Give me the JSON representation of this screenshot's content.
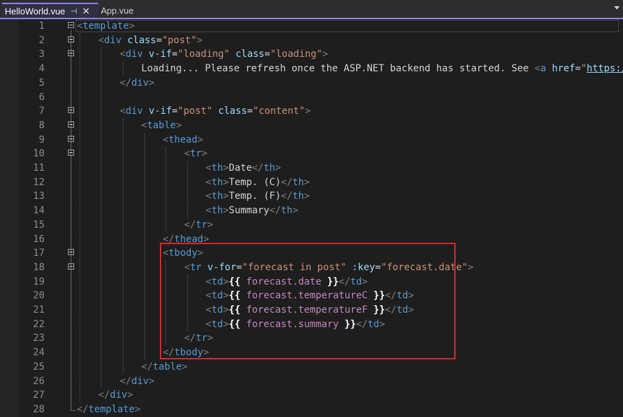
{
  "tabs": [
    {
      "label": "HelloWorld.vue",
      "active": true,
      "pinned": true
    },
    {
      "label": "App.vue",
      "active": false
    }
  ],
  "icons": {
    "pin": "pin-icon",
    "close": "close-icon",
    "overflow": "chevron-down-icon",
    "fold": "collapse-icon"
  },
  "colors": {
    "accent": "#9184ee",
    "highlight": "#e0262b",
    "tag": "#569cd6",
    "attribute": "#9cdcfe",
    "value": "#ce9178",
    "expression": "#c586c0"
  },
  "editor": {
    "highlight_lines": [
      17,
      24
    ],
    "lines": [
      {
        "n": "1",
        "indent": 0,
        "fold": true,
        "tokens": [
          {
            "t": "t",
            "v": "<"
          },
          {
            "t": "tn",
            "v": "template"
          },
          {
            "t": "t",
            "v": ">"
          }
        ]
      },
      {
        "n": "2",
        "indent": 1,
        "fold": true,
        "tokens": [
          {
            "t": "t",
            "v": "<"
          },
          {
            "t": "tn",
            "v": "div"
          },
          {
            "t": "tx",
            "v": " "
          },
          {
            "t": "an",
            "v": "class"
          },
          {
            "t": "tx",
            "v": "="
          },
          {
            "t": "av",
            "v": "\"post\""
          },
          {
            "t": "t",
            "v": ">"
          }
        ]
      },
      {
        "n": "3",
        "indent": 2,
        "fold": true,
        "tokens": [
          {
            "t": "t",
            "v": "<"
          },
          {
            "t": "tn",
            "v": "div"
          },
          {
            "t": "tx",
            "v": " "
          },
          {
            "t": "an",
            "v": "v-if"
          },
          {
            "t": "tx",
            "v": "="
          },
          {
            "t": "av",
            "v": "\"loading\""
          },
          {
            "t": "tx",
            "v": " "
          },
          {
            "t": "an",
            "v": "class"
          },
          {
            "t": "tx",
            "v": "="
          },
          {
            "t": "av",
            "v": "\"loading\""
          },
          {
            "t": "t",
            "v": ">"
          }
        ]
      },
      {
        "n": "4",
        "indent": 3,
        "fold": false,
        "tokens": [
          {
            "t": "tx",
            "v": "Loading... Please refresh once the ASP.NET backend has started. See "
          },
          {
            "t": "t",
            "v": "<"
          },
          {
            "t": "tn",
            "v": "a"
          },
          {
            "t": "tx",
            "v": " "
          },
          {
            "t": "an",
            "v": "href"
          },
          {
            "t": "tx",
            "v": "="
          },
          {
            "t": "av",
            "v": "\""
          },
          {
            "t": "lnk",
            "v": "https://aka."
          }
        ]
      },
      {
        "n": "5",
        "indent": 2,
        "fold": false,
        "tokens": [
          {
            "t": "t",
            "v": "</"
          },
          {
            "t": "tn",
            "v": "div"
          },
          {
            "t": "t",
            "v": ">"
          }
        ]
      },
      {
        "n": "6",
        "indent": 0,
        "fold": false,
        "tokens": []
      },
      {
        "n": "7",
        "indent": 2,
        "fold": true,
        "tokens": [
          {
            "t": "t",
            "v": "<"
          },
          {
            "t": "tn",
            "v": "div"
          },
          {
            "t": "tx",
            "v": " "
          },
          {
            "t": "an",
            "v": "v-if"
          },
          {
            "t": "tx",
            "v": "="
          },
          {
            "t": "av",
            "v": "\"post\""
          },
          {
            "t": "tx",
            "v": " "
          },
          {
            "t": "an",
            "v": "class"
          },
          {
            "t": "tx",
            "v": "="
          },
          {
            "t": "av",
            "v": "\"content\""
          },
          {
            "t": "t",
            "v": ">"
          }
        ]
      },
      {
        "n": "8",
        "indent": 3,
        "fold": true,
        "tokens": [
          {
            "t": "t",
            "v": "<"
          },
          {
            "t": "tn",
            "v": "table"
          },
          {
            "t": "t",
            "v": ">"
          }
        ]
      },
      {
        "n": "9",
        "indent": 4,
        "fold": true,
        "tokens": [
          {
            "t": "t",
            "v": "<"
          },
          {
            "t": "tn",
            "v": "thead"
          },
          {
            "t": "t",
            "v": ">"
          }
        ]
      },
      {
        "n": "10",
        "indent": 5,
        "fold": true,
        "tokens": [
          {
            "t": "t",
            "v": "<"
          },
          {
            "t": "tn",
            "v": "tr"
          },
          {
            "t": "t",
            "v": ">"
          }
        ]
      },
      {
        "n": "11",
        "indent": 6,
        "fold": false,
        "tokens": [
          {
            "t": "t",
            "v": "<"
          },
          {
            "t": "tn",
            "v": "th"
          },
          {
            "t": "t",
            "v": ">"
          },
          {
            "t": "tx",
            "v": "Date"
          },
          {
            "t": "t",
            "v": "</"
          },
          {
            "t": "tn",
            "v": "th"
          },
          {
            "t": "t",
            "v": ">"
          }
        ]
      },
      {
        "n": "12",
        "indent": 6,
        "fold": false,
        "tokens": [
          {
            "t": "t",
            "v": "<"
          },
          {
            "t": "tn",
            "v": "th"
          },
          {
            "t": "t",
            "v": ">"
          },
          {
            "t": "tx",
            "v": "Temp. (C)"
          },
          {
            "t": "t",
            "v": "</"
          },
          {
            "t": "tn",
            "v": "th"
          },
          {
            "t": "t",
            "v": ">"
          }
        ]
      },
      {
        "n": "13",
        "indent": 6,
        "fold": false,
        "tokens": [
          {
            "t": "t",
            "v": "<"
          },
          {
            "t": "tn",
            "v": "th"
          },
          {
            "t": "t",
            "v": ">"
          },
          {
            "t": "tx",
            "v": "Temp. (F)"
          },
          {
            "t": "t",
            "v": "</"
          },
          {
            "t": "tn",
            "v": "th"
          },
          {
            "t": "t",
            "v": ">"
          }
        ]
      },
      {
        "n": "14",
        "indent": 6,
        "fold": false,
        "tokens": [
          {
            "t": "t",
            "v": "<"
          },
          {
            "t": "tn",
            "v": "th"
          },
          {
            "t": "t",
            "v": ">"
          },
          {
            "t": "tx",
            "v": "Summary"
          },
          {
            "t": "t",
            "v": "</"
          },
          {
            "t": "tn",
            "v": "th"
          },
          {
            "t": "t",
            "v": ">"
          }
        ]
      },
      {
        "n": "15",
        "indent": 5,
        "fold": false,
        "tokens": [
          {
            "t": "t",
            "v": "</"
          },
          {
            "t": "tn",
            "v": "tr"
          },
          {
            "t": "t",
            "v": ">"
          }
        ]
      },
      {
        "n": "16",
        "indent": 4,
        "fold": false,
        "tokens": [
          {
            "t": "t",
            "v": "</"
          },
          {
            "t": "tn",
            "v": "thead"
          },
          {
            "t": "t",
            "v": ">"
          }
        ]
      },
      {
        "n": "17",
        "indent": 4,
        "fold": true,
        "tokens": [
          {
            "t": "t",
            "v": "<"
          },
          {
            "t": "tn",
            "v": "tbody"
          },
          {
            "t": "t",
            "v": ">"
          }
        ]
      },
      {
        "n": "18",
        "indent": 5,
        "fold": true,
        "tokens": [
          {
            "t": "t",
            "v": "<"
          },
          {
            "t": "tn",
            "v": "tr"
          },
          {
            "t": "tx",
            "v": " "
          },
          {
            "t": "an",
            "v": "v-for"
          },
          {
            "t": "tx",
            "v": "="
          },
          {
            "t": "av",
            "v": "\"forecast in post\""
          },
          {
            "t": "tx",
            "v": " "
          },
          {
            "t": "an",
            "v": ":key"
          },
          {
            "t": "tx",
            "v": "="
          },
          {
            "t": "av",
            "v": "\"forecast.date\""
          },
          {
            "t": "t",
            "v": ">"
          }
        ]
      },
      {
        "n": "19",
        "indent": 6,
        "fold": false,
        "tokens": [
          {
            "t": "t",
            "v": "<"
          },
          {
            "t": "tn",
            "v": "td"
          },
          {
            "t": "t",
            "v": ">"
          },
          {
            "t": "br",
            "v": "{{"
          },
          {
            "t": "tx",
            "v": " "
          },
          {
            "t": "ex",
            "v": "forecast.date"
          },
          {
            "t": "tx",
            "v": " "
          },
          {
            "t": "br",
            "v": "}}"
          },
          {
            "t": "t",
            "v": "</"
          },
          {
            "t": "tn",
            "v": "td"
          },
          {
            "t": "t",
            "v": ">"
          }
        ]
      },
      {
        "n": "20",
        "indent": 6,
        "fold": false,
        "tokens": [
          {
            "t": "t",
            "v": "<"
          },
          {
            "t": "tn",
            "v": "td"
          },
          {
            "t": "t",
            "v": ">"
          },
          {
            "t": "br",
            "v": "{{"
          },
          {
            "t": "tx",
            "v": " "
          },
          {
            "t": "ex",
            "v": "forecast.temperatureC"
          },
          {
            "t": "tx",
            "v": " "
          },
          {
            "t": "br",
            "v": "}}"
          },
          {
            "t": "t",
            "v": "</"
          },
          {
            "t": "tn",
            "v": "td"
          },
          {
            "t": "t",
            "v": ">"
          }
        ]
      },
      {
        "n": "21",
        "indent": 6,
        "fold": false,
        "tokens": [
          {
            "t": "t",
            "v": "<"
          },
          {
            "t": "tn",
            "v": "td"
          },
          {
            "t": "t",
            "v": ">"
          },
          {
            "t": "br",
            "v": "{{"
          },
          {
            "t": "tx",
            "v": " "
          },
          {
            "t": "ex",
            "v": "forecast.temperatureF"
          },
          {
            "t": "tx",
            "v": " "
          },
          {
            "t": "br",
            "v": "}}"
          },
          {
            "t": "t",
            "v": "</"
          },
          {
            "t": "tn",
            "v": "td"
          },
          {
            "t": "t",
            "v": ">"
          }
        ]
      },
      {
        "n": "22",
        "indent": 6,
        "fold": false,
        "tokens": [
          {
            "t": "t",
            "v": "<"
          },
          {
            "t": "tn",
            "v": "td"
          },
          {
            "t": "t",
            "v": ">"
          },
          {
            "t": "br",
            "v": "{{"
          },
          {
            "t": "tx",
            "v": " "
          },
          {
            "t": "ex",
            "v": "forecast.summary"
          },
          {
            "t": "tx",
            "v": " "
          },
          {
            "t": "br",
            "v": "}}"
          },
          {
            "t": "t",
            "v": "</"
          },
          {
            "t": "tn",
            "v": "td"
          },
          {
            "t": "t",
            "v": ">"
          }
        ]
      },
      {
        "n": "23",
        "indent": 5,
        "fold": false,
        "tokens": [
          {
            "t": "t",
            "v": "</"
          },
          {
            "t": "tn",
            "v": "tr"
          },
          {
            "t": "t",
            "v": ">"
          }
        ]
      },
      {
        "n": "24",
        "indent": 4,
        "fold": false,
        "tokens": [
          {
            "t": "t",
            "v": "</"
          },
          {
            "t": "tn",
            "v": "tbody"
          },
          {
            "t": "t",
            "v": ">"
          }
        ]
      },
      {
        "n": "25",
        "indent": 3,
        "fold": false,
        "tokens": [
          {
            "t": "t",
            "v": "</"
          },
          {
            "t": "tn",
            "v": "table"
          },
          {
            "t": "t",
            "v": ">"
          }
        ]
      },
      {
        "n": "26",
        "indent": 2,
        "fold": false,
        "tokens": [
          {
            "t": "t",
            "v": "</"
          },
          {
            "t": "tn",
            "v": "div"
          },
          {
            "t": "t",
            "v": ">"
          }
        ]
      },
      {
        "n": "27",
        "indent": 1,
        "fold": false,
        "tokens": [
          {
            "t": "t",
            "v": "</"
          },
          {
            "t": "tn",
            "v": "div"
          },
          {
            "t": "t",
            "v": ">"
          }
        ]
      },
      {
        "n": "28",
        "indent": 0,
        "fold": false,
        "tokens": [
          {
            "t": "t",
            "v": "</"
          },
          {
            "t": "tn",
            "v": "template"
          },
          {
            "t": "t",
            "v": ">"
          }
        ]
      }
    ]
  }
}
